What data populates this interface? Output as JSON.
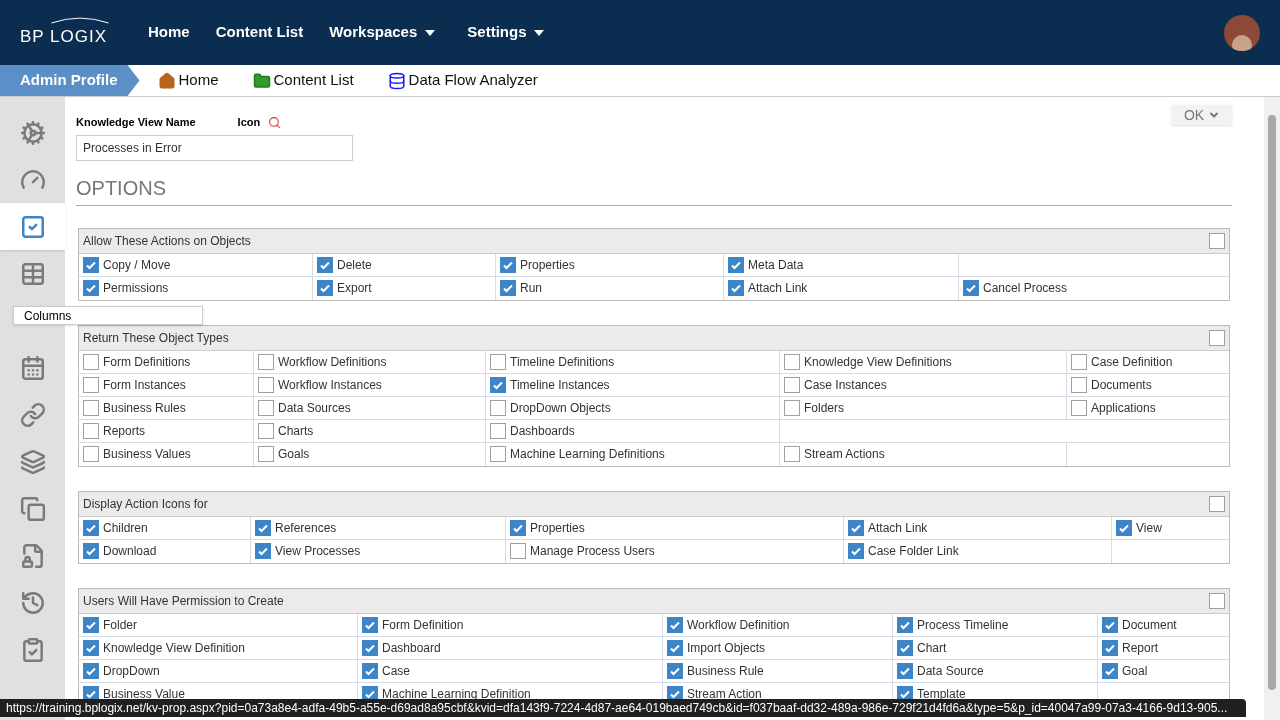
{
  "header": {
    "logo": "BP LOGIX",
    "nav": [
      {
        "label": "Home",
        "dropdown": false
      },
      {
        "label": "Content List",
        "dropdown": false
      },
      {
        "label": "Workspaces",
        "dropdown": true
      },
      {
        "label": "Settings",
        "dropdown": true
      }
    ]
  },
  "breadcrumb": {
    "profile": "Admin Profile",
    "links": [
      {
        "kind": "home",
        "label": "Home"
      },
      {
        "kind": "folder",
        "label": "Content List"
      },
      {
        "kind": "database",
        "label": "Data Flow Analyzer"
      }
    ]
  },
  "sidebar": {
    "items": [
      {
        "kind": "gears",
        "selected": false
      },
      {
        "kind": "gauge",
        "selected": false
      },
      {
        "kind": "check",
        "selected": true
      },
      {
        "kind": "table",
        "selected": false
      },
      {
        "kind": "tooltip",
        "label": "Columns"
      },
      {
        "kind": "calendar",
        "selected": false
      },
      {
        "kind": "link",
        "selected": false
      },
      {
        "kind": "squares",
        "selected": false
      },
      {
        "kind": "copy",
        "selected": false
      },
      {
        "kind": "filelock",
        "selected": false
      },
      {
        "kind": "history",
        "selected": false
      },
      {
        "kind": "clipboard",
        "selected": false
      }
    ]
  },
  "form": {
    "name_label": "Knowledge View Name",
    "icon_label": "Icon",
    "name_value": "Processes in Error",
    "ok_button": "OK"
  },
  "options_title": "OPTIONS",
  "sections": [
    {
      "title": "Allow These Actions on Objects",
      "header_checked": false,
      "rows": [
        [
          {
            "label": "Copy / Move",
            "checked": true
          },
          {
            "label": "Delete",
            "checked": true
          },
          {
            "label": "Properties",
            "checked": true
          },
          {
            "label": "Meta Data",
            "checked": true
          },
          null
        ],
        [
          {
            "label": "Permissions",
            "checked": true
          },
          {
            "label": "Export",
            "checked": true
          },
          {
            "label": "Run",
            "checked": true
          },
          {
            "label": "Attach Link",
            "checked": true
          },
          {
            "label": "Cancel Process",
            "checked": true
          }
        ]
      ]
    },
    {
      "title": "Return These Object Types",
      "header_checked": false,
      "rows": [
        [
          {
            "label": "Form Definitions",
            "checked": false
          },
          {
            "label": "Workflow Definitions",
            "checked": false
          },
          {
            "label": "Timeline Definitions",
            "checked": false
          },
          {
            "label": "Knowledge View Definitions",
            "checked": false
          },
          {
            "label": "Case Definition",
            "checked": false
          }
        ],
        [
          {
            "label": "Form Instances",
            "checked": false
          },
          {
            "label": "Workflow Instances",
            "checked": false
          },
          {
            "label": "Timeline Instances",
            "checked": true
          },
          {
            "label": "Case Instances",
            "checked": false
          },
          {
            "label": "Documents",
            "checked": false
          }
        ],
        [
          {
            "label": "Business Rules",
            "checked": false
          },
          {
            "label": "Data Sources",
            "checked": false
          },
          {
            "label": "DropDown Objects",
            "checked": false
          },
          {
            "label": "Folders",
            "checked": false
          },
          {
            "label": "Applications",
            "checked": false
          }
        ],
        [
          {
            "label": "Reports",
            "checked": false
          },
          {
            "label": "Charts",
            "checked": false
          },
          {
            "label": "Dashboards",
            "checked": false
          },
          null,
          null
        ],
        [
          {
            "label": "Business Values",
            "checked": false
          },
          {
            "label": "Goals",
            "checked": false
          },
          {
            "label": "Machine Learning Definitions",
            "checked": false
          },
          {
            "label": "Stream Actions",
            "checked": false
          },
          null
        ]
      ]
    },
    {
      "title": "Display Action Icons for",
      "header_checked": false,
      "rows": [
        [
          {
            "label": "Children",
            "checked": true
          },
          {
            "label": "References",
            "checked": true
          },
          {
            "label": "Properties",
            "checked": true
          },
          {
            "label": "Attach Link",
            "checked": true
          },
          {
            "label": "View",
            "checked": true
          }
        ],
        [
          {
            "label": "Download",
            "checked": true
          },
          {
            "label": "View Processes",
            "checked": true
          },
          {
            "label": "Manage Process Users",
            "checked": false
          },
          {
            "label": "Case Folder Link",
            "checked": true
          },
          null
        ]
      ]
    },
    {
      "title": "Users Will Have Permission to Create",
      "header_checked": false,
      "rows": [
        [
          {
            "label": "Folder",
            "checked": true
          },
          {
            "label": "Form Definition",
            "checked": true
          },
          {
            "label": "Workflow Definition",
            "checked": true
          },
          {
            "label": "Process Timeline",
            "checked": true
          },
          {
            "label": "Document",
            "checked": true
          }
        ],
        [
          {
            "label": "Knowledge View Definition",
            "checked": true
          },
          {
            "label": "Dashboard",
            "checked": true
          },
          {
            "label": "Import Objects",
            "checked": true
          },
          {
            "label": "Chart",
            "checked": true
          },
          {
            "label": "Report",
            "checked": true
          }
        ],
        [
          {
            "label": "DropDown",
            "checked": true
          },
          {
            "label": "Case",
            "checked": true
          },
          {
            "label": "Business Rule",
            "checked": true
          },
          {
            "label": "Data Source",
            "checked": true
          },
          {
            "label": "Goal",
            "checked": true
          }
        ],
        [
          {
            "label": "Business Value",
            "checked": true
          },
          {
            "label": "Machine Learning Definition",
            "checked": true
          },
          {
            "label": "Stream Action",
            "checked": true
          },
          {
            "label": "Template",
            "checked": true
          },
          null
        ]
      ]
    }
  ],
  "status_url": "https://training.bplogix.net/kv-prop.aspx?pid=0a73a8e4-adfa-49b5-a55e-d69ad8a95cbf&kvid=dfa143f9-7224-4d87-ae64-019baed749cb&id=f037baaf-dd32-489a-986e-729f21d4fd6a&type=5&p_id=40047a99-07a3-4166-9d13-905..."
}
